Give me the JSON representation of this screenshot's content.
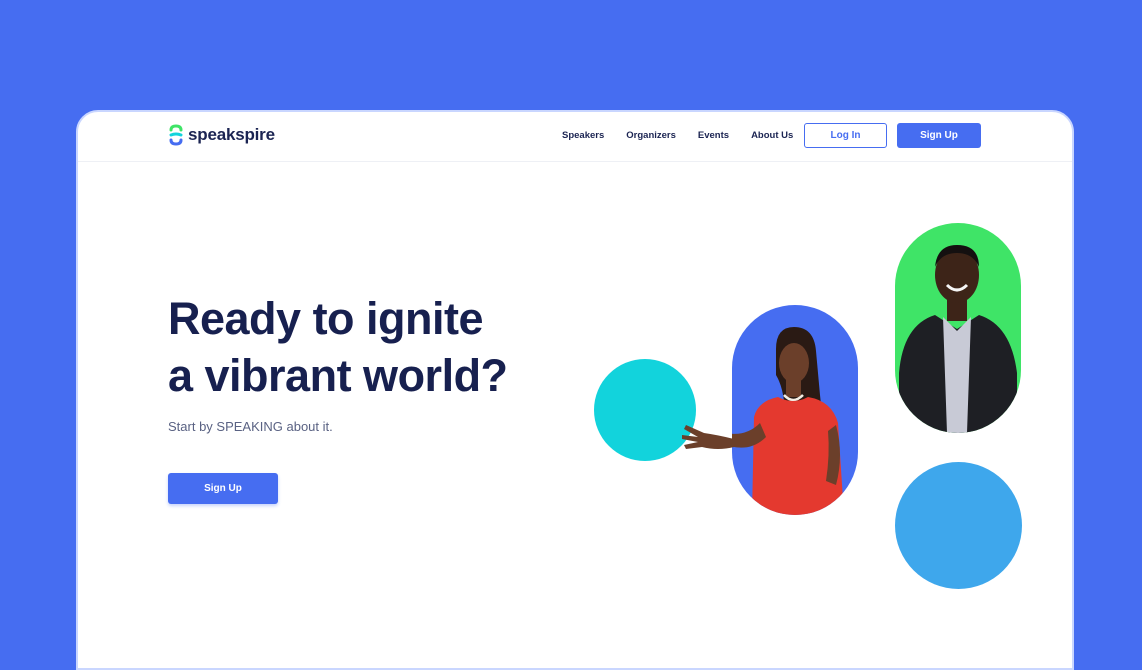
{
  "brand": {
    "name": "speakspire",
    "logo_colors": [
      "#466df1",
      "#3fe467",
      "#12d3dc"
    ]
  },
  "nav": {
    "links": [
      "Speakers",
      "Organizers",
      "Events",
      "About Us"
    ],
    "login_label": "Log In",
    "signup_label": "Sign Up"
  },
  "hero": {
    "headline_line1": "Ready to ignite",
    "headline_line2": "a vibrant world?",
    "subhead": "Start by SPEAKING about it.",
    "cta_label": "Sign Up"
  },
  "colors": {
    "background": "#466df1",
    "primary": "#466df1",
    "text_dark": "#17204f",
    "cyan": "#12d3dc",
    "green": "#3fe467",
    "sky": "#3ea7ec"
  }
}
